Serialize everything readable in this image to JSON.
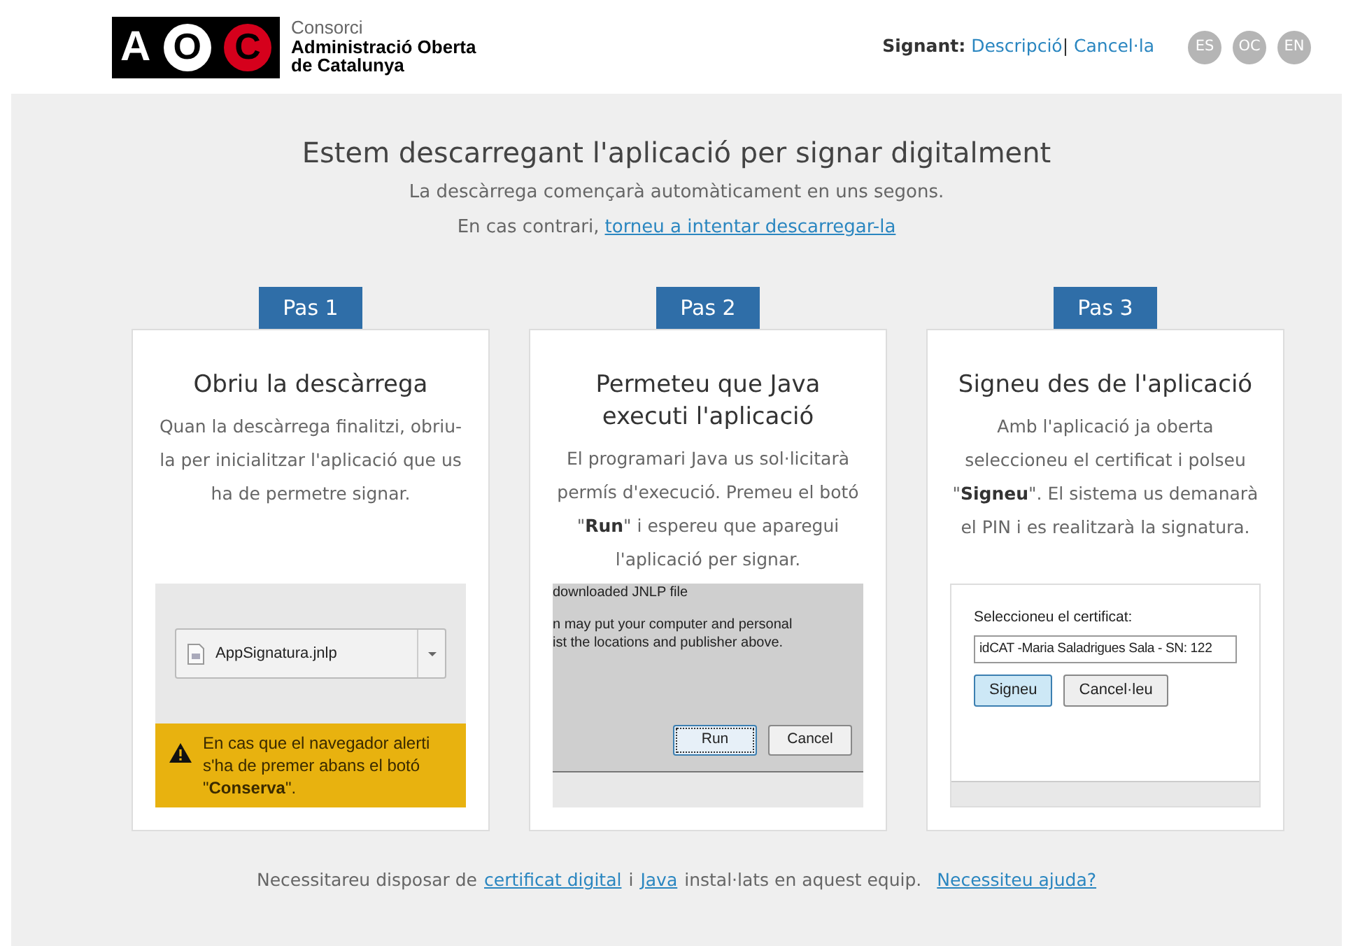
{
  "header": {
    "logo": {
      "letters": [
        "A",
        "O",
        "C"
      ],
      "lines": [
        "Consorci",
        "Administració Oberta",
        "de Catalunya"
      ]
    },
    "signant": {
      "label": "Signant:",
      "links": [
        "Descripció",
        "Cancel·la"
      ],
      "separator": "|"
    },
    "languages": [
      {
        "label": "ES"
      },
      {
        "label": "OC"
      },
      {
        "label": "EN"
      }
    ]
  },
  "intro": {
    "title": "Estem descarregant l'aplicació per signar digitalment",
    "subtitle": "La descàrrega començarà automàticament en uns segons.",
    "retry_prefix": "En cas contrari,",
    "retry_link": "torneu a intentar descarregar-la"
  },
  "steps": [
    {
      "tab": "Pas 1",
      "title": "Obriu la descàrrega",
      "text": "Quan la descàrrega finalitzi, obriu-la per inicialitzar l'aplicació que us ha de permetre signar.",
      "screenshot": {
        "kind": "download",
        "file": "AppSignatura.jnlp",
        "alert": "En cas que el navegador alerti s'ha de premer abans el botó \"**Conserva**\"."
      }
    },
    {
      "tab": "Pas 2",
      "title": "Permeteu que Java executi l'aplicació",
      "text": "El programari Java us sol·licitarà permís d'execució. Premeu el botó \"**Run**\" i espereu que aparegui l'aplicació per signar.",
      "screenshot": {
        "kind": "java",
        "lines": [
          "downloaded JNLP file",
          "n may put your computer and personal",
          "ist the locations and publisher above."
        ],
        "buttons": [
          {
            "label": "Run",
            "focused": true
          },
          {
            "label": "Cancel",
            "focused": false
          }
        ]
      }
    },
    {
      "tab": "Pas 3",
      "title": "Signeu des de l'aplicació",
      "text": "Amb l'aplicació ja oberta seleccioneu el certificat i polseu \"**Signeu**\". El sistema us demanarà el PIN i es realitzarà la signatura.",
      "screenshot": {
        "kind": "cert",
        "label": "Seleccioneu el certificat:",
        "value": "idCAT -Maria Saladrigues Sala - SN: 122",
        "buttons": [
          {
            "label": "Signeu",
            "focused": true
          },
          {
            "label": "Cancel·leu",
            "focused": false
          }
        ]
      }
    }
  ],
  "footer": [
    {
      "kind": "text",
      "text": "Necessitareu disposar de"
    },
    {
      "kind": "link",
      "text": "certificat digital"
    },
    {
      "kind": "text",
      "text": "i"
    },
    {
      "kind": "link",
      "text": "Java"
    },
    {
      "kind": "text",
      "text": "instal·lats en aquest equip."
    },
    {
      "kind": "link",
      "text": "Necessiteu ajuda?"
    }
  ]
}
